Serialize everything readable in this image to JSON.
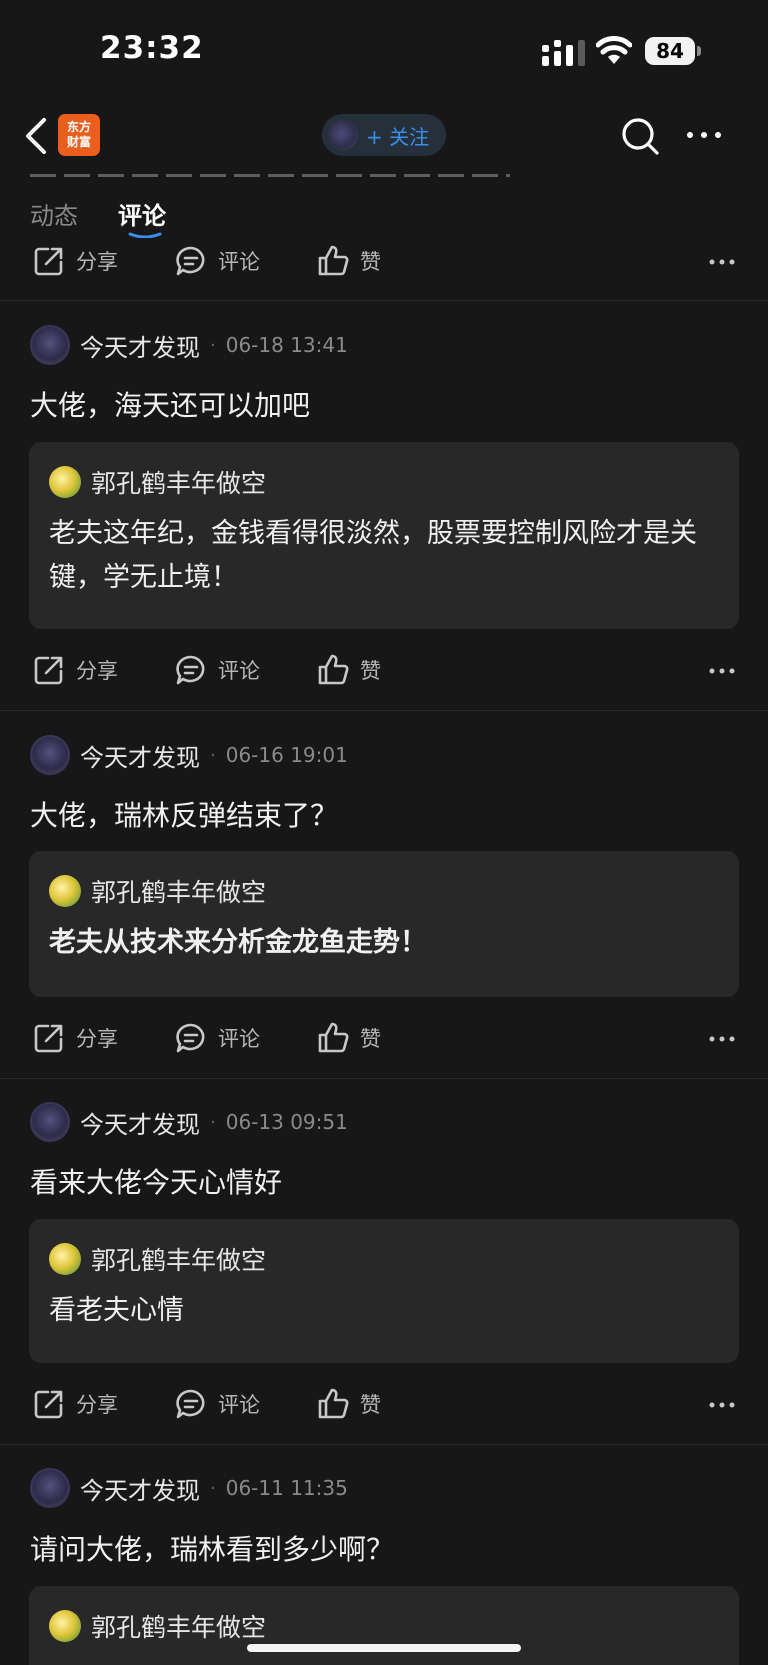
{
  "status_bar": {
    "time": "23:32",
    "battery": "84"
  },
  "nav": {
    "logo_text": "东方\n财富",
    "follow_label": "+ 关注"
  },
  "tabs": [
    {
      "label": "动态"
    },
    {
      "label": "评论"
    }
  ],
  "action_labels": {
    "share": "分享",
    "comment": "评论",
    "like": "赞"
  },
  "comments": [
    {
      "author": "今天才发现",
      "date": "06-18 13:41",
      "text": "大佬，海天还可以加吧",
      "reply": {
        "author": "郭孔鹤丰年做空",
        "text": "老夫这年纪，金钱看得很淡然，股票要控制风险才是关键，学无止境！"
      }
    },
    {
      "author": "今天才发现",
      "date": "06-16 19:01",
      "text": "大佬，瑞林反弹结束了？",
      "reply": {
        "author": "郭孔鹤丰年做空",
        "text": "老夫从技术来分析金龙鱼走势！"
      }
    },
    {
      "author": "今天才发现",
      "date": "06-13 09:51",
      "text": "看来大佬今天心情好",
      "reply": {
        "author": "郭孔鹤丰年做空",
        "text": "看老夫心情"
      }
    },
    {
      "author": "今天才发现",
      "date": "06-11 11:35",
      "text": "请问大佬，瑞林看到多少啊？",
      "reply": {
        "author": "郭孔鹤丰年做空",
        "text": ""
      }
    }
  ],
  "colors": {
    "background": "#171717",
    "card": "#282828",
    "accent": "#3a8ef0",
    "brand": "#ea5f1d"
  }
}
